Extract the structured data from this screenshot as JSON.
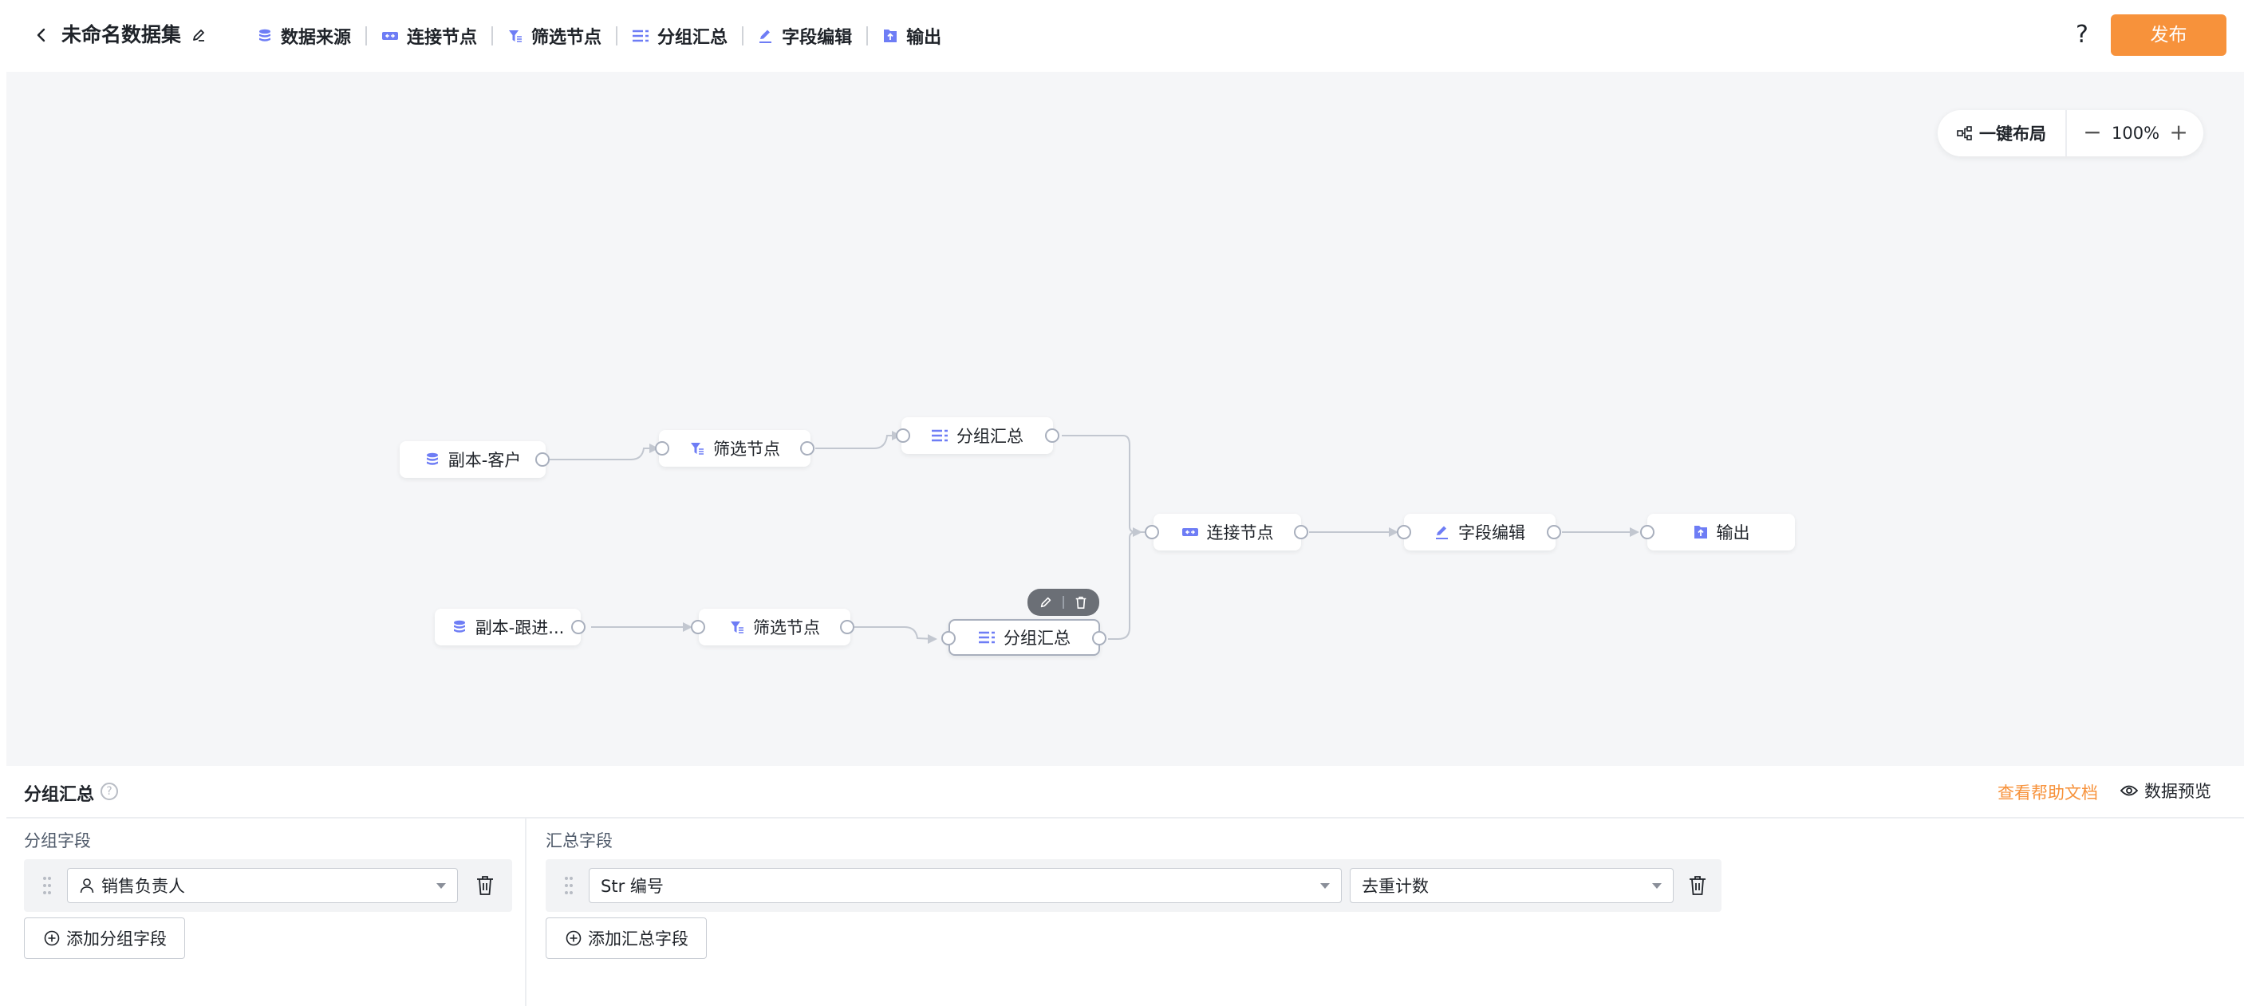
{
  "header": {
    "title": "未命名数据集",
    "toolbar": [
      "数据来源",
      "连接节点",
      "筛选节点",
      "分组汇总",
      "字段编辑",
      "输出"
    ],
    "help": "?",
    "publish": "发布"
  },
  "canvas": {
    "layout_button": "一键布局",
    "zoom": "100%",
    "nodes": {
      "src1": "副本-客户",
      "filter1": "筛选节点",
      "group1": "分组汇总",
      "src2": "副本-跟进...",
      "filter2": "筛选节点",
      "group2": "分组汇总",
      "join": "连接节点",
      "edit": "字段编辑",
      "output": "输出"
    }
  },
  "panel": {
    "title": "分组汇总",
    "help_link": "查看帮助文档",
    "preview": "数据预览",
    "group_label": "分组字段",
    "group_field": "销售负责人",
    "add_group": "添加分组字段",
    "agg_label": "汇总字段",
    "agg_field": "Str 编号",
    "agg_method": "去重计数",
    "add_agg": "添加汇总字段"
  },
  "colors": {
    "accent": "#f7923b",
    "icon": "#6e7df5",
    "canvas_bg": "#f5f6f8"
  }
}
